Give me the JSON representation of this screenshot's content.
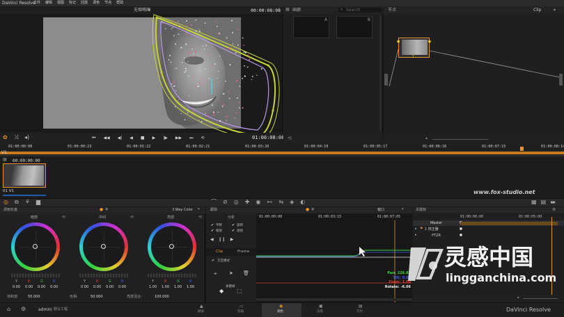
{
  "app": {
    "name": "DaVinci Resolve",
    "menu": [
      "文件",
      "编辑",
      "视图",
      "标记",
      "回放",
      "调色",
      "节点",
      "帮助"
    ]
  },
  "viewer": {
    "mode_label": "无缩略图",
    "timecode": "00:00:08:08",
    "transport_timecode": "01:00:08:08"
  },
  "gallery": {
    "title": "画廊",
    "search_placeholder": "Search",
    "still_a": "A",
    "still_b": "B"
  },
  "nodes": {
    "title": "节点",
    "mode": "Clip",
    "node_label": "1"
  },
  "timeline": {
    "track": "V1",
    "ticks": [
      "01:00:00:00",
      "01:00:00:23",
      "01:00:01:22",
      "01:00:02:21",
      "01:00:03:20",
      "01:00:04:19",
      "01:00:05:17",
      "01:00:06:16",
      "01:00:07:15",
      "01:00:08:14"
    ],
    "clip_timecode": "00:00:00:00",
    "clip_label": "01  V1"
  },
  "watermark": {
    "top": "www.fox-studio.net",
    "brand_cn": "灵感中国",
    "brand_url": "lingganchina.com"
  },
  "color_wheels": {
    "title": "调色轮盘",
    "mode": "3 Way Color",
    "wheels": [
      {
        "name": "暗部",
        "channels": [
          "Y",
          "R",
          "G",
          "B"
        ],
        "values": [
          "0.00",
          "0.00",
          "0.00",
          "0.00"
        ]
      },
      {
        "name": "中间",
        "channels": [
          "Y",
          "R",
          "G",
          "B"
        ],
        "values": [
          "0.00",
          "0.00",
          "0.00",
          "0.00"
        ]
      },
      {
        "name": "亮部",
        "channels": [
          "Y",
          "R",
          "G",
          "B"
        ],
        "values": [
          "1.00",
          "1.00",
          "1.00",
          "1.00"
        ]
      }
    ],
    "footer": [
      {
        "label": "饱和度:",
        "value": "50.000"
      },
      {
        "label": "色相:",
        "value": "50.000"
      },
      {
        "label": "亮度混合:",
        "value": "100.000"
      }
    ]
  },
  "tracker": {
    "title": "跟踪",
    "analyze": "分析",
    "checks": [
      "平移",
      "旋转",
      "缩放",
      "透视"
    ],
    "tab_clip": "Clip",
    "tab_frame": "Frame",
    "options": [
      "交互模式",
      "关键帧"
    ],
    "window_label": "窗口",
    "graph_times": [
      "01:00:00:00",
      "01:00:03:15",
      "01:00:07:05"
    ],
    "readouts": [
      {
        "label": "Pan:",
        "value": "226.81",
        "color": "#39d14a"
      },
      {
        "label": "Tilt:",
        "value": "0.00",
        "color": "#3a5bdc"
      },
      {
        "label": "Zoom:",
        "value": "1.00",
        "color": "#e03a2f"
      },
      {
        "label": "Rotate:",
        "value": "-6.06",
        "color": "#f0f0f0"
      }
    ]
  },
  "keyframes": {
    "title": "关键帧",
    "times": [
      "01:00:00:00",
      "01:00:05:00"
    ],
    "master": "Master",
    "rows": [
      "1  校正器",
      "PTZR"
    ]
  },
  "bottom_bar": {
    "user": "admin",
    "project": "默认工程",
    "pages": [
      "媒体",
      "剪辑",
      "调色",
      "渲染",
      "交付"
    ],
    "active_page": 2,
    "brand": "DaVinci Resolve"
  },
  "colors": {
    "accent": "#e8912a",
    "spline_outer": "#c9d43a",
    "spline_inner": "#b99be8"
  }
}
